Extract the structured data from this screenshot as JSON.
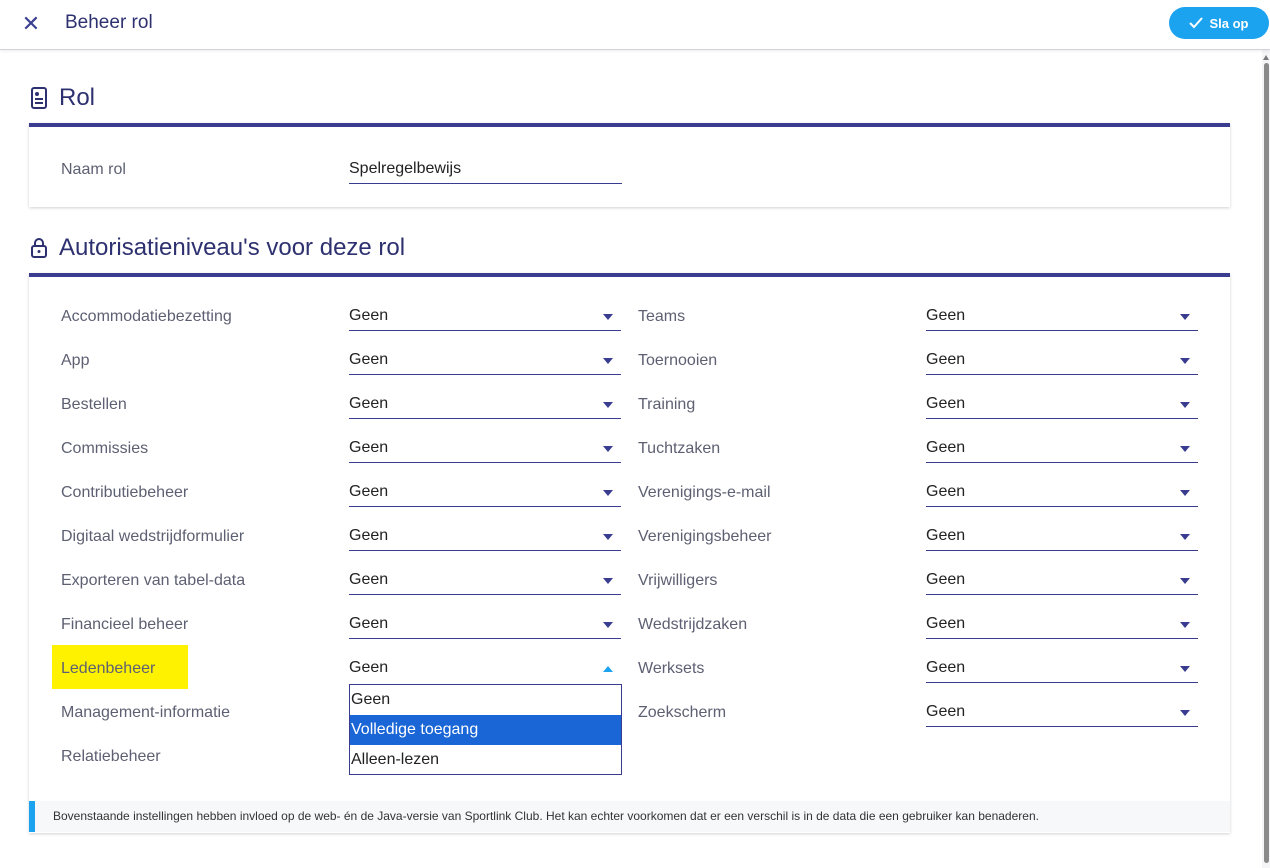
{
  "header": {
    "close_icon": "close-icon",
    "title": "Beheer rol",
    "save_label": "Sla op",
    "save_icon": "check-icon",
    "accent": "#1ba3f0"
  },
  "role_section": {
    "icon": "badge-icon",
    "title": "Rol",
    "name_label": "Naam rol",
    "name_value": "Spelregelbewijs"
  },
  "auth_section": {
    "icon": "lock-icon",
    "title": "Autorisatieniveau's voor deze rol",
    "left": [
      {
        "label": "Accommodatiebezetting",
        "value": "Geen"
      },
      {
        "label": "App",
        "value": "Geen"
      },
      {
        "label": "Bestellen",
        "value": "Geen"
      },
      {
        "label": "Commissies",
        "value": "Geen"
      },
      {
        "label": "Contributiebeheer",
        "value": "Geen"
      },
      {
        "label": "Digitaal wedstrijdformulier",
        "value": "Geen"
      },
      {
        "label": "Exporteren van tabel-data",
        "value": "Geen"
      },
      {
        "label": "Financieel beheer",
        "value": "Geen"
      },
      {
        "label": "Ledenbeheer",
        "value": "Geen"
      },
      {
        "label": "Management-informatie",
        "value": ""
      },
      {
        "label": "Relatiebeheer",
        "value": ""
      }
    ],
    "right": [
      {
        "label": "Teams",
        "value": "Geen"
      },
      {
        "label": "Toernooien",
        "value": "Geen"
      },
      {
        "label": "Training",
        "value": "Geen"
      },
      {
        "label": "Tuchtzaken",
        "value": "Geen"
      },
      {
        "label": "Verenigings-e-mail",
        "value": "Geen"
      },
      {
        "label": "Verenigingsbeheer",
        "value": "Geen"
      },
      {
        "label": "Vrijwilligers",
        "value": "Geen"
      },
      {
        "label": "Wedstrijdzaken",
        "value": "Geen"
      },
      {
        "label": "Werksets",
        "value": "Geen"
      },
      {
        "label": "Zoekscherm",
        "value": "Geen"
      }
    ],
    "open_dropdown": {
      "for": "Ledenbeheer",
      "options": [
        "Geen",
        "Volledige toegang",
        "Alleen-lezen"
      ],
      "hovered": "Volledige toegang"
    }
  },
  "info": {
    "text": "Bovenstaande instellingen hebben invloed op de web- én de Java-versie van Sportlink Club. Het kan echter voorkomen dat er een verschil is in de data die een gebruiker kan benaderen."
  }
}
